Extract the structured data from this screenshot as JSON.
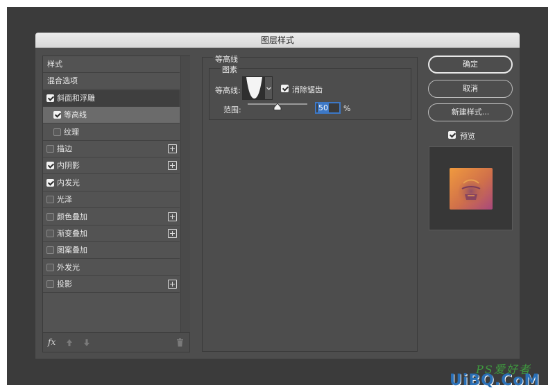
{
  "window": {
    "title": "图层样式"
  },
  "style_list": {
    "items": [
      {
        "label": "样式",
        "checkbox": false,
        "checked": false,
        "plus": false
      },
      {
        "label": "混合选项",
        "checkbox": false,
        "checked": false,
        "plus": false
      },
      {
        "label": "斜面和浮雕",
        "checkbox": true,
        "checked": true,
        "plus": false
      },
      {
        "label": "等高线",
        "checkbox": true,
        "checked": true,
        "plus": false
      },
      {
        "label": "纹理",
        "checkbox": true,
        "checked": false,
        "plus": false
      },
      {
        "label": "描边",
        "checkbox": true,
        "checked": false,
        "plus": true
      },
      {
        "label": "内阴影",
        "checkbox": true,
        "checked": true,
        "plus": true
      },
      {
        "label": "内发光",
        "checkbox": true,
        "checked": true,
        "plus": false
      },
      {
        "label": "光泽",
        "checkbox": true,
        "checked": false,
        "plus": false
      },
      {
        "label": "颜色叠加",
        "checkbox": true,
        "checked": false,
        "plus": true
      },
      {
        "label": "渐变叠加",
        "checkbox": true,
        "checked": false,
        "plus": true
      },
      {
        "label": "图案叠加",
        "checkbox": true,
        "checked": false,
        "plus": false
      },
      {
        "label": "外发光",
        "checkbox": true,
        "checked": false,
        "plus": false
      },
      {
        "label": "投影",
        "checkbox": true,
        "checked": false,
        "plus": true
      }
    ],
    "footer": {
      "fx_label": "fx"
    }
  },
  "contour": {
    "section_title": "等高线",
    "group_title": "图素",
    "contour_label": "等高线:",
    "antialias_label": "消除锯齿",
    "antialias_checked": true,
    "range_label": "范围:",
    "range_value": "50",
    "range_unit": "%",
    "range_fraction": 0.5
  },
  "actions": {
    "ok_label": "确定",
    "cancel_label": "取消",
    "new_style_label": "新建样式...",
    "preview_label": "预览",
    "preview_checked": true
  },
  "watermark": {
    "text": "UiBQ.CoM",
    "script": "PS爱好者"
  },
  "colors": {
    "panel_bg": "#4d4d4d",
    "selected_row": "#6b6b6b",
    "accent_blue": "#3d78c6",
    "swatch_orange": "#e8873f",
    "swatch_magenta": "#b04c7a",
    "watermark_green": "#3f9a3f",
    "watermark_blue": "#2a6fb5"
  }
}
